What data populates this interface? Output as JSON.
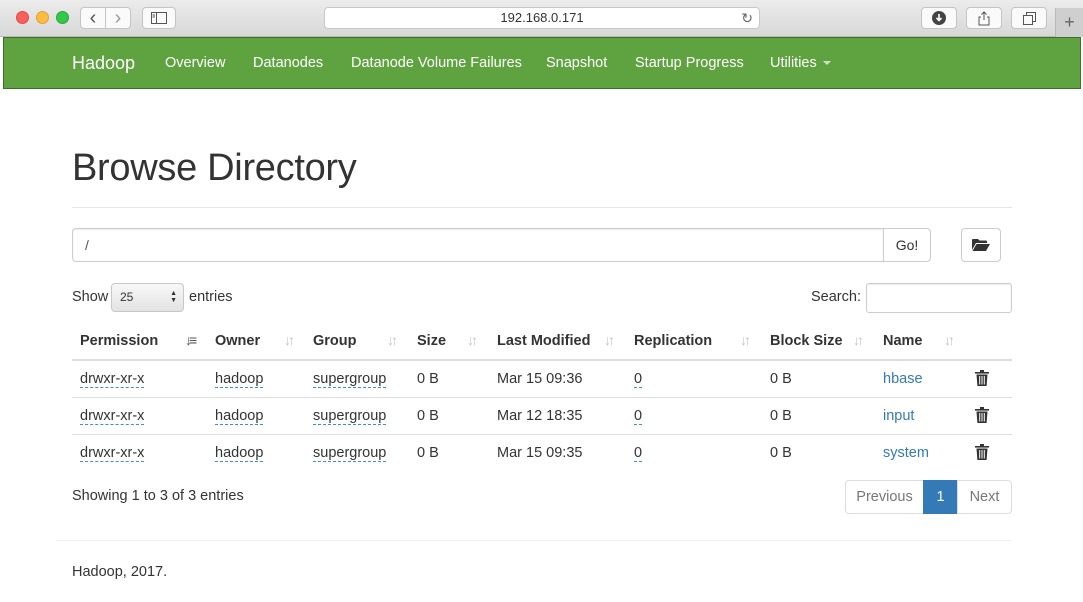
{
  "browser": {
    "url": "192.168.0.171",
    "back_icon": "‹",
    "forward_icon": "›",
    "reload_icon": "↻",
    "new_tab_icon": "+"
  },
  "navbar": {
    "brand": "Hadoop",
    "items": [
      "Overview",
      "Datanodes",
      "Datanode Volume Failures",
      "Snapshot",
      "Startup Progress",
      "Utilities"
    ],
    "color": "#5fa341"
  },
  "page": {
    "title": "Browse Directory",
    "path_value": "/",
    "go_label": "Go!"
  },
  "controls": {
    "show_label": "Show",
    "page_size": "25",
    "entries_label": "entries",
    "search_label": "Search:"
  },
  "table": {
    "columns": [
      "Permission",
      "Owner",
      "Group",
      "Size",
      "Last Modified",
      "Replication",
      "Block Size",
      "Name"
    ],
    "rows": [
      {
        "permission": "drwxr-xr-x",
        "owner": "hadoop",
        "group": "supergroup",
        "size": "0 B",
        "modified": "Mar 15 09:36",
        "replication": "0",
        "block_size": "0 B",
        "name": "hbase"
      },
      {
        "permission": "drwxr-xr-x",
        "owner": "hadoop",
        "group": "supergroup",
        "size": "0 B",
        "modified": "Mar 12 18:35",
        "replication": "0",
        "block_size": "0 B",
        "name": "input"
      },
      {
        "permission": "drwxr-xr-x",
        "owner": "hadoop",
        "group": "supergroup",
        "size": "0 B",
        "modified": "Mar 15 09:35",
        "replication": "0",
        "block_size": "0 B",
        "name": "system"
      }
    ]
  },
  "pagination": {
    "info": "Showing 1 to 3 of 3 entries",
    "previous": "Previous",
    "current": "1",
    "next": "Next"
  },
  "footer": {
    "text": "Hadoop, 2017."
  }
}
